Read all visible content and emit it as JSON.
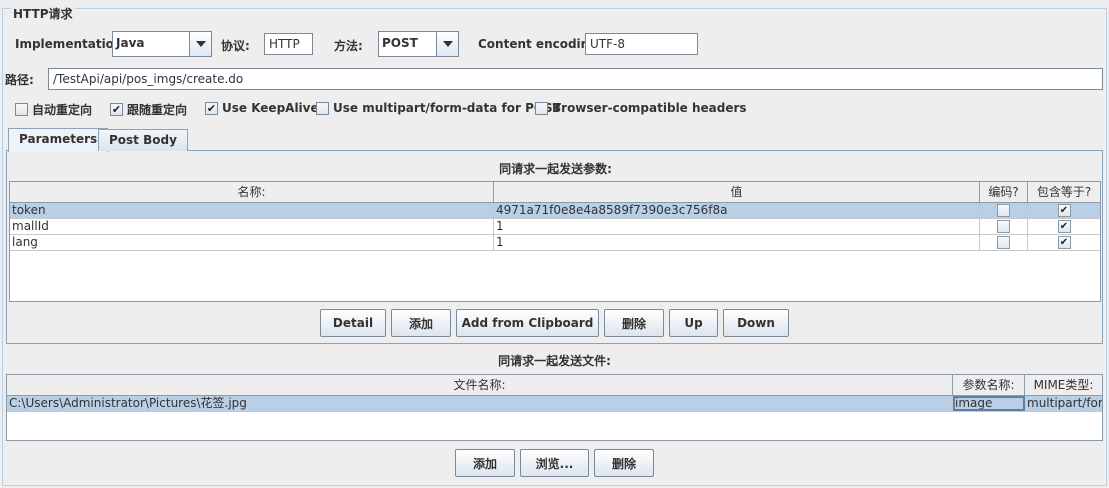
{
  "group_title": "HTTP请求",
  "row1": {
    "implementation_label": "Implementation:",
    "implementation_value": "Java",
    "protocol_label": "协议:",
    "protocol_value": "HTTP",
    "method_label": "方法:",
    "method_value": "POST",
    "encoding_label": "Content encoding:",
    "encoding_value": "UTF-8"
  },
  "path": {
    "label": "路径:",
    "value": "/TestApi/api/pos_imgs/create.do"
  },
  "options": [
    {
      "label": "自动重定向",
      "checked": false
    },
    {
      "label": "跟随重定向",
      "checked": true
    },
    {
      "label": "Use KeepAlive",
      "checked": true
    },
    {
      "label": "Use multipart/form-data for POST",
      "checked": false
    },
    {
      "label": "Browser-compatible headers",
      "checked": false
    }
  ],
  "tabs": [
    {
      "label": "Parameters",
      "active": true
    },
    {
      "label": "Post Body",
      "active": false
    }
  ],
  "params": {
    "caption": "同请求一起发送参数:",
    "columns": [
      "名称:",
      "值",
      "编码?",
      "包含等于?"
    ],
    "rows": [
      {
        "name": "token",
        "value": "4971a71f0e8e4a8589f7390e3c756f8a",
        "encode": false,
        "include_equals": true
      },
      {
        "name": "mallId",
        "value": "1",
        "encode": false,
        "include_equals": true
      },
      {
        "name": "lang",
        "value": "1",
        "encode": false,
        "include_equals": true
      }
    ],
    "buttons": [
      "Detail",
      "添加",
      "Add from Clipboard",
      "删除",
      "Up",
      "Down"
    ]
  },
  "files": {
    "caption": "同请求一起发送文件:",
    "columns": [
      "文件名称:",
      "参数名称:",
      "MIME类型:"
    ],
    "rows": [
      {
        "path": "C:\\Users\\Administrator\\Pictures\\花签.jpg",
        "param": "image",
        "mime": "multipart/for..."
      }
    ],
    "buttons": [
      "添加",
      "浏览...",
      "删除"
    ]
  },
  "check_mark": "✔"
}
